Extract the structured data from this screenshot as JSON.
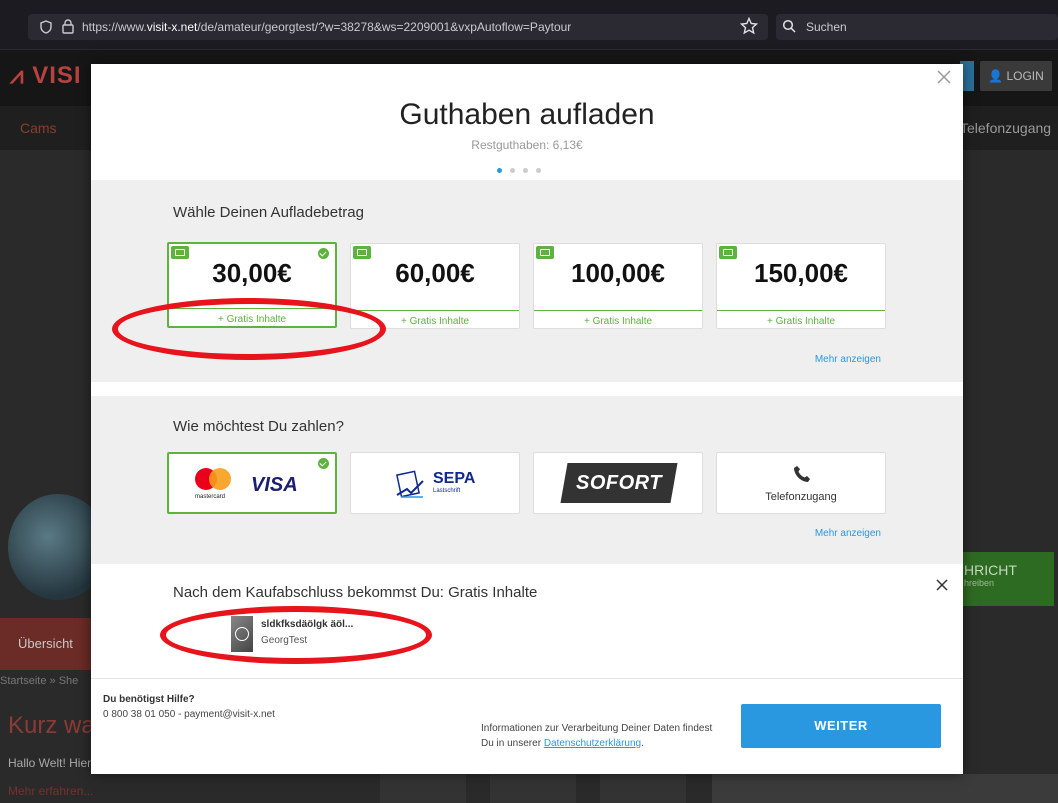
{
  "browser": {
    "url_prefix": "https://www.",
    "url_host": "visit-x.net",
    "url_path": "/de/amateur/georgtest/?w=38278&ws=2209001&vxpAutoflow=Paytour",
    "search_placeholder": "Suchen"
  },
  "site": {
    "logo_text": "VISI",
    "login_label": "LOGIN",
    "nav_cams": "Cams",
    "nav_telefon": "Telefonzugang",
    "tab_overview": "Übersicht",
    "breadcrumb": "Startseite » She",
    "heading": "Kurz was",
    "intro_text": "Hallo Welt! Hier",
    "more_link": "Mehr erfahren...",
    "message_button": "HRICHT",
    "message_button_sub": "hreiben"
  },
  "modal": {
    "title": "Guthaben aufladen",
    "subtitle": "Restguthaben: 6,13€",
    "step_count": 4,
    "active_step": 0,
    "amount_section_title": "Wähle Deinen Aufladebetrag",
    "amounts": [
      {
        "value": "30,00€",
        "bonus": "+ Gratis Inhalte",
        "selected": true
      },
      {
        "value": "60,00€",
        "bonus": "+ Gratis Inhalte",
        "selected": false
      },
      {
        "value": "100,00€",
        "bonus": "+ Gratis Inhalte",
        "selected": false
      },
      {
        "value": "150,00€",
        "bonus": "+ Gratis Inhalte",
        "selected": false
      }
    ],
    "amount_more": "Mehr anzeigen",
    "pay_section_title": "Wie möchtest Du zahlen?",
    "payment_methods": [
      {
        "name": "VISA",
        "sub": "mastercard",
        "selected": true
      },
      {
        "name": "SEPA",
        "sub": "Lastschrift",
        "selected": false
      },
      {
        "name": "SOFORT",
        "selected": false
      },
      {
        "name": "Telefonzugang",
        "selected": false
      }
    ],
    "pay_more": "Mehr anzeigen",
    "gratis_title": "Nach dem Kaufabschluss bekommst Du: Gratis Inhalte",
    "gratis_item": {
      "name": "sldkfksdäölgk äöl...",
      "author": "GeorgTest"
    },
    "help_title": "Du benötigst Hilfe?",
    "help_contact": "0 800 38 01 050 - payment@visit-x.net",
    "privacy_text": "Informationen zur Verarbeitung Deiner Daten findest Du in unserer",
    "privacy_link": "Datenschutzerklärung",
    "privacy_end": ".",
    "submit_label": "WEITER"
  },
  "colors": {
    "accent_blue": "#2a98e0",
    "success_green": "#5db33e",
    "annotation_red": "#e8141c"
  }
}
